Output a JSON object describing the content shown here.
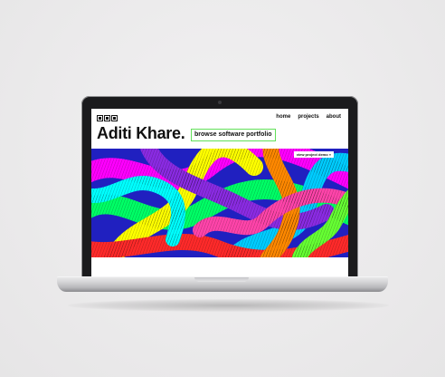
{
  "site": {
    "nav": [
      "home",
      "projects",
      "about"
    ],
    "title": "Aditi Khare.",
    "browse_button": "browse software portfolio",
    "demo_button": "view project demo »"
  },
  "icons": {
    "logo": "three-square-logo-icon",
    "camera": "camera-icon"
  },
  "colors": {
    "background": "#ecebec",
    "accent_green": "#62e05a",
    "art_palette": [
      "#ff00ff",
      "#00ff66",
      "#ffff00",
      "#ff2a2a",
      "#00ccff",
      "#2020c0",
      "#ff8800",
      "#8a2be2"
    ]
  }
}
